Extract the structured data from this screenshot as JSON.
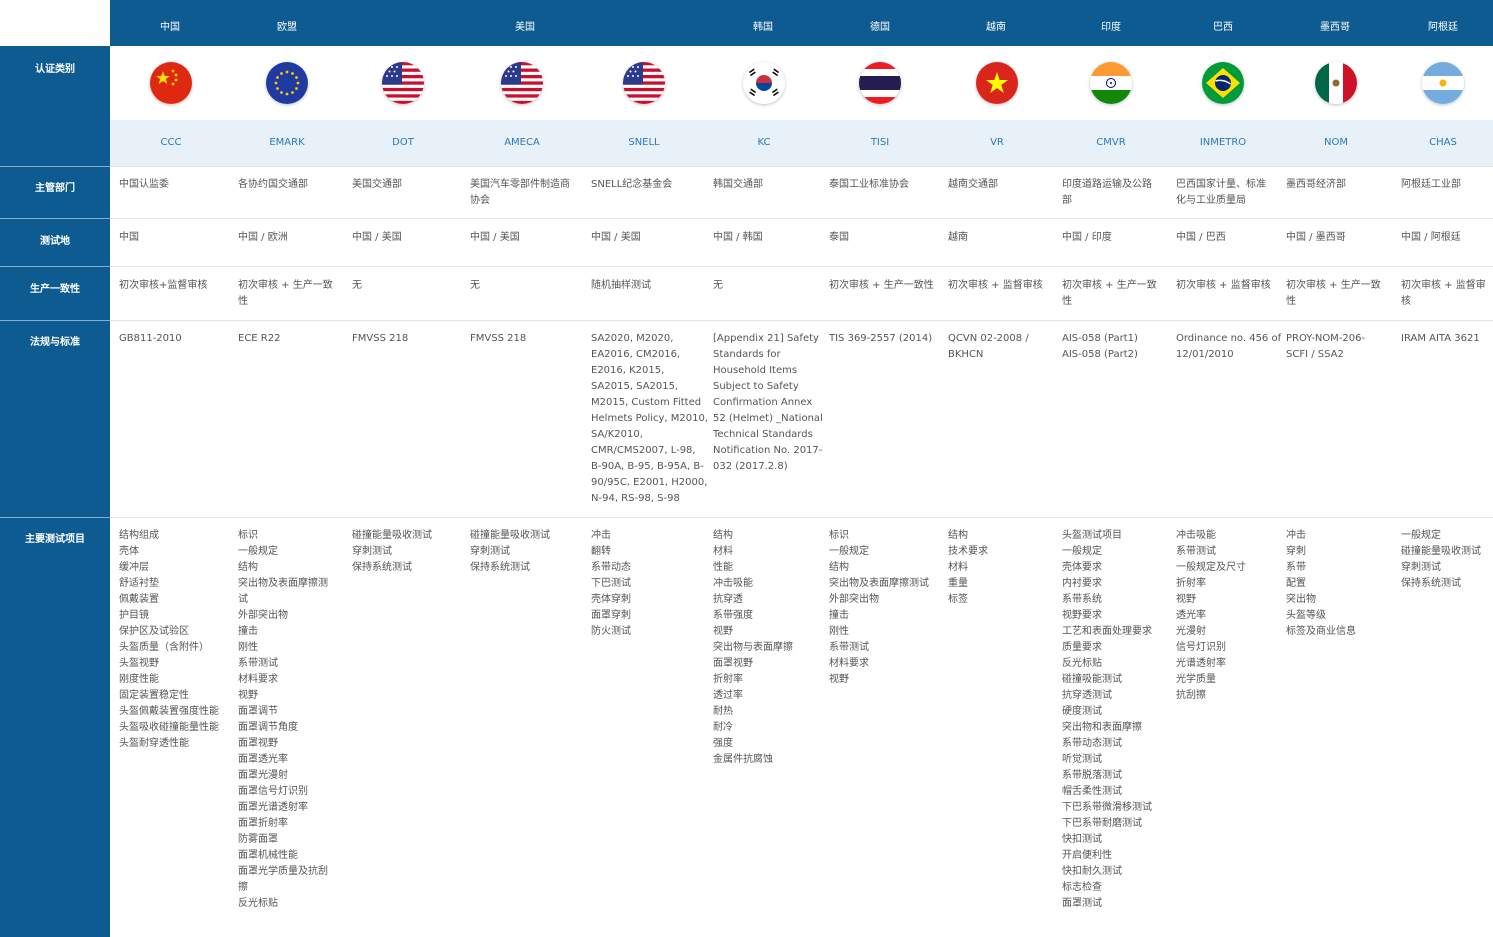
{
  "countries": [
    "中国",
    "欧盟",
    "美国",
    "韩国",
    "德国",
    "越南",
    "印度",
    "巴西",
    "墨西哥",
    "阿根廷"
  ],
  "row_labels": {
    "cert_type": "认证类别",
    "authority": "主管部门",
    "test_location": "测试地",
    "conformity": "生产一致性",
    "standards": "法规与标准",
    "main_tests": "主要测试项目"
  },
  "flags": [
    "china-flag-icon",
    "eu-flag-icon",
    "usa-flag-icon",
    "usa-flag-icon",
    "usa-flag-icon",
    "korea-flag-icon",
    "thailand-flag-icon",
    "vietnam-flag-icon",
    "india-flag-icon",
    "brazil-flag-icon",
    "mexico-flag-icon",
    "argentina-flag-icon"
  ],
  "columns": [
    {
      "code": "CCC",
      "authority": "中国认监委",
      "location": "中国",
      "conformity": "初次审核+监督审核",
      "standard": "GB811-2010",
      "tests": "结构组成\n壳体\n缓冲层\n舒适衬垫\n佩戴装置\n护目镜\n保护区及试验区\n头盔质量（含附件）\n头盔视野\n刚度性能\n固定装置稳定性\n头盔佩戴装置强度性能\n头盔吸收碰撞能量性能\n头盔耐穿透性能"
    },
    {
      "code": "EMARK",
      "authority": "各协约国交通部",
      "location": "中国 / 欧洲",
      "conformity": "初次审核 + 生产一致\n性",
      "standard": "ECE R22",
      "tests": "标识\n一般规定\n结构\n突出物及表面摩擦测\n试\n外部突出物\n撞击\n刚性\n系带测试\n材料要求\n视野\n面罩调节\n面罩调节角度\n面罩视野\n面罩透光率\n面罩光漫射\n面罩信号灯识别\n面罩光谱透射率\n面罩折射率\n防雾面罩\n面罩机械性能\n面罩光学质量及抗刮\n擦\n反光标贴"
    },
    {
      "code": "DOT",
      "authority": "美国交通部",
      "location": "中国 / 美国",
      "conformity": "无",
      "standard": "FMVSS 218",
      "tests": "碰撞能量吸收测试\n穿刺测试\n保持系统测试"
    },
    {
      "code": "AMECA",
      "authority": "美国汽车零部件制造商\n协会",
      "location": "中国 / 美国",
      "conformity": "无",
      "standard": "FMVSS 218",
      "tests": "碰撞能量吸收测试\n穿刺测试\n保持系统测试"
    },
    {
      "code": "SNELL",
      "authority": "SNELL纪念基金会",
      "location": "中国 / 美国",
      "conformity": "随机抽样测试",
      "standard": "SA2020, M2020,\nEA2016, CM2016,\nE2016, K2015,\nSA2015, SA2015,\nM2015, Custom Fitted\nHelmets Policy, M2010,\nSA/K2010,\nCMR/CMS2007, L-98,\nB-90A, B-95, B-95A, B-\n90/95C, E2001, H2000,\nN-94, RS-98, S-98",
      "tests": "冲击\n翻转\n系带动态\n下巴测试\n壳体穿刺\n面罩穿刺\n防火测试"
    },
    {
      "code": "KC",
      "authority": "韩国交通部",
      "location": "中国 / 韩国",
      "conformity": "无",
      "standard": "[Appendix 21] Safety\nStandards for\nHousehold Items\nSubject to Safety\nConfirmation Annex\n52 (Helmet) _National\nTechnical Standards\nNotification No. 2017-\n032 (2017.2.8)",
      "tests": "结构\n材料\n性能\n冲击吸能\n抗穿透\n系带强度\n视野\n突出物与表面摩擦\n面罩视野\n折射率\n透过率\n耐热\n耐冷\n强度\n金属件抗腐蚀"
    },
    {
      "code": "TISI",
      "authority": "泰国工业标准协会",
      "location": "泰国",
      "conformity": "初次审核 + 生产一致性",
      "standard": "TIS 369-2557 (2014)",
      "tests": "标识\n一般规定\n结构\n突出物及表面摩擦测试\n外部突出物\n撞击\n刚性\n系带测试\n材料要求\n视野"
    },
    {
      "code": "VR",
      "authority": "越南交通部",
      "location": "越南",
      "conformity": "初次审核 + 监督审核",
      "standard": "QCVN 02-2008 /\nBKHCN",
      "tests": "结构\n技术要求\n材料\n重量\n标签"
    },
    {
      "code": "CMVR",
      "authority": "印度道路运输及公路\n部",
      "location": "中国 / 印度",
      "conformity": "初次审核 + 生产一致\n性",
      "standard": "AIS-058 (Part1)\nAIS-058 (Part2)",
      "tests": "头盔测试项目\n一般规定\n壳体要求\n内衬要求\n系带系统\n视野要求\n工艺和表面处理要求\n质量要求\n反光标贴\n碰撞吸能测试\n抗穿透测试\n硬度测试\n突出物和表面摩擦\n系带动态测试\n听觉测试\n系带脱落测试\n帽舌柔性测试\n下巴系带微滑移测试\n下巴系带耐磨测试\n快扣测试\n开启便利性\n快扣耐久测试\n标志检查\n面罩测试"
    },
    {
      "code": "INMETRO",
      "authority": "巴西国家计量、标准\n化与工业质量局",
      "location": "中国 / 巴西",
      "conformity": "初次审核 + 监督审核",
      "standard": "Ordinance no. 456 of\n12/01/2010",
      "tests": "冲击吸能\n系带测试\n一般规定及尺寸\n折射率\n视野\n透光率\n光漫射\n信号灯识别\n光谱透射率\n光学质量\n抗刮擦"
    },
    {
      "code": "NOM",
      "authority": "墨西哥经济部",
      "location": "中国 / 墨西哥",
      "conformity": "初次审核 + 生产一致\n性",
      "standard": "PROY-NOM-206-\nSCFI / SSA2",
      "tests": "冲击\n穿刺\n系带\n配置\n突出物\n头盔等级\n标签及商业信息"
    },
    {
      "code": "CHAS",
      "authority": "阿根廷工业部",
      "location": "中国 / 阿根廷",
      "conformity": "初次审核 + 监督审\n核",
      "standard": "IRAM AITA 3621",
      "tests": "一般规定\n碰撞能量吸收测试\n穿刺测试\n保持系统测试"
    }
  ]
}
